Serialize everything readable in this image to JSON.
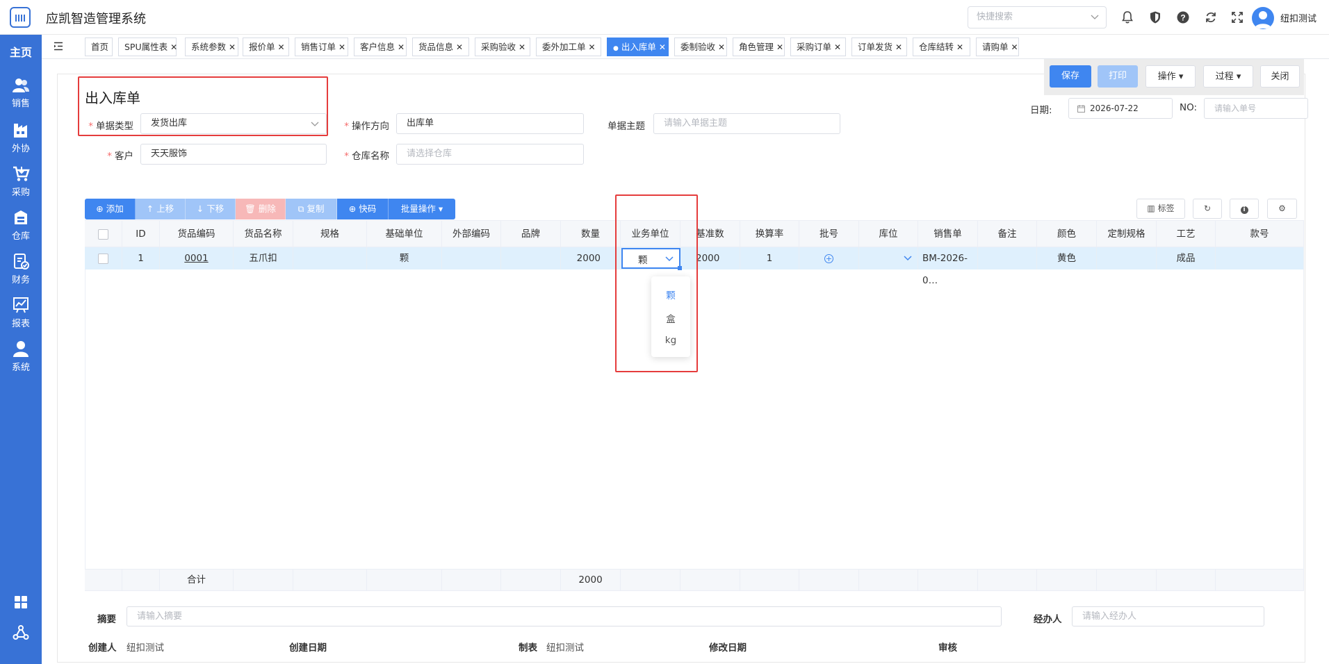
{
  "app": {
    "title": "应凯智造管理系统"
  },
  "header": {
    "search_placeholder": "快捷搜索",
    "username": "纽扣测试"
  },
  "sidebar": {
    "home": "主页",
    "items": [
      {
        "label": "销售",
        "icon": "users-icon"
      },
      {
        "label": "外协",
        "icon": "outsource-icon"
      },
      {
        "label": "采购",
        "icon": "cart-icon"
      },
      {
        "label": "仓库",
        "icon": "warehouse-icon"
      },
      {
        "label": "财务",
        "icon": "finance-icon"
      },
      {
        "label": "报表",
        "icon": "report-icon"
      },
      {
        "label": "系统",
        "icon": "user-icon"
      }
    ]
  },
  "tabs": [
    {
      "label": "首页",
      "closable": false
    },
    {
      "label": "SPU属性表",
      "closable": true
    },
    {
      "label": "系统参数",
      "closable": true
    },
    {
      "label": "报价单",
      "closable": true
    },
    {
      "label": "销售订单",
      "closable": true
    },
    {
      "label": "客户信息",
      "closable": true
    },
    {
      "label": "货品信息",
      "closable": true
    },
    {
      "label": "采购验收",
      "closable": true
    },
    {
      "label": "委外加工单",
      "closable": true
    },
    {
      "label": "出入库单",
      "closable": true,
      "active": true
    },
    {
      "label": "委制验收",
      "closable": true
    },
    {
      "label": "角色管理",
      "closable": true
    },
    {
      "label": "采购订单",
      "closable": true
    },
    {
      "label": "订单发货",
      "closable": true
    },
    {
      "label": "仓库结转",
      "closable": true
    },
    {
      "label": "请购单",
      "closable": true
    }
  ],
  "toolbar": {
    "save": "保存",
    "print": "打印",
    "operate": "操作",
    "process": "过程",
    "close": "关闭"
  },
  "form": {
    "title": "出入库单",
    "doc_type_label": "单据类型",
    "doc_type_value": "发货出库",
    "direction_label": "操作方向",
    "direction_value": "出库单",
    "subject_label": "单据主题",
    "subject_placeholder": "请输入单据主题",
    "customer_label": "客户",
    "customer_value": "天天服饰",
    "warehouse_label": "仓库名称",
    "warehouse_placeholder": "请选择仓库",
    "date_label": "日期:",
    "date_value": "2026-07-22",
    "no_label": "NO:",
    "no_placeholder": "请输入单号"
  },
  "grid_buttons": {
    "add": "添加",
    "up": "上移",
    "down": "下移",
    "delete": "删除",
    "copy": "复制",
    "quick": "快码",
    "batch": "批量操作"
  },
  "grid_side_buttons": {
    "label": "标签"
  },
  "table": {
    "columns": [
      "ID",
      "货品编码",
      "货品名称",
      "规格",
      "基础单位",
      "外部编码",
      "品牌",
      "数量",
      "业务单位",
      "基准数",
      "换算率",
      "批号",
      "库位",
      "销售单",
      "备注",
      "颜色",
      "定制规格",
      "工艺",
      "款号"
    ],
    "row": {
      "id": "1",
      "code": "0001",
      "name": "五爪扣",
      "spec": "",
      "base_unit": "颗",
      "ext_code": "",
      "brand": "",
      "qty": "2000",
      "biz_unit": "颗",
      "base_qty": "2000",
      "rate": "1",
      "batch": "",
      "location": "",
      "sales_order": "BM-2026-0…",
      "remark": "",
      "color": "黄色",
      "custom_spec": "",
      "craft": "成品",
      "style_no": ""
    },
    "footer": {
      "label": "合计",
      "qty": "2000"
    },
    "unit_options": [
      "颗",
      "盒",
      "kg"
    ]
  },
  "bottom": {
    "summary_label": "摘要",
    "summary_placeholder": "请输入摘要",
    "handler_label": "经办人",
    "handler_placeholder": "请输入经办人",
    "creator_label": "创建人",
    "creator_value": "纽扣测试",
    "created_date_label": "创建日期",
    "maker_label": "制表",
    "maker_value": "纽扣测试",
    "modified_date_label": "修改日期",
    "auditor_label": "审核"
  },
  "colors": {
    "primary": "#3f86f0",
    "sidebar": "#3872d6",
    "highlight": "#e53c3c",
    "row_selected": "#dff0fd"
  }
}
